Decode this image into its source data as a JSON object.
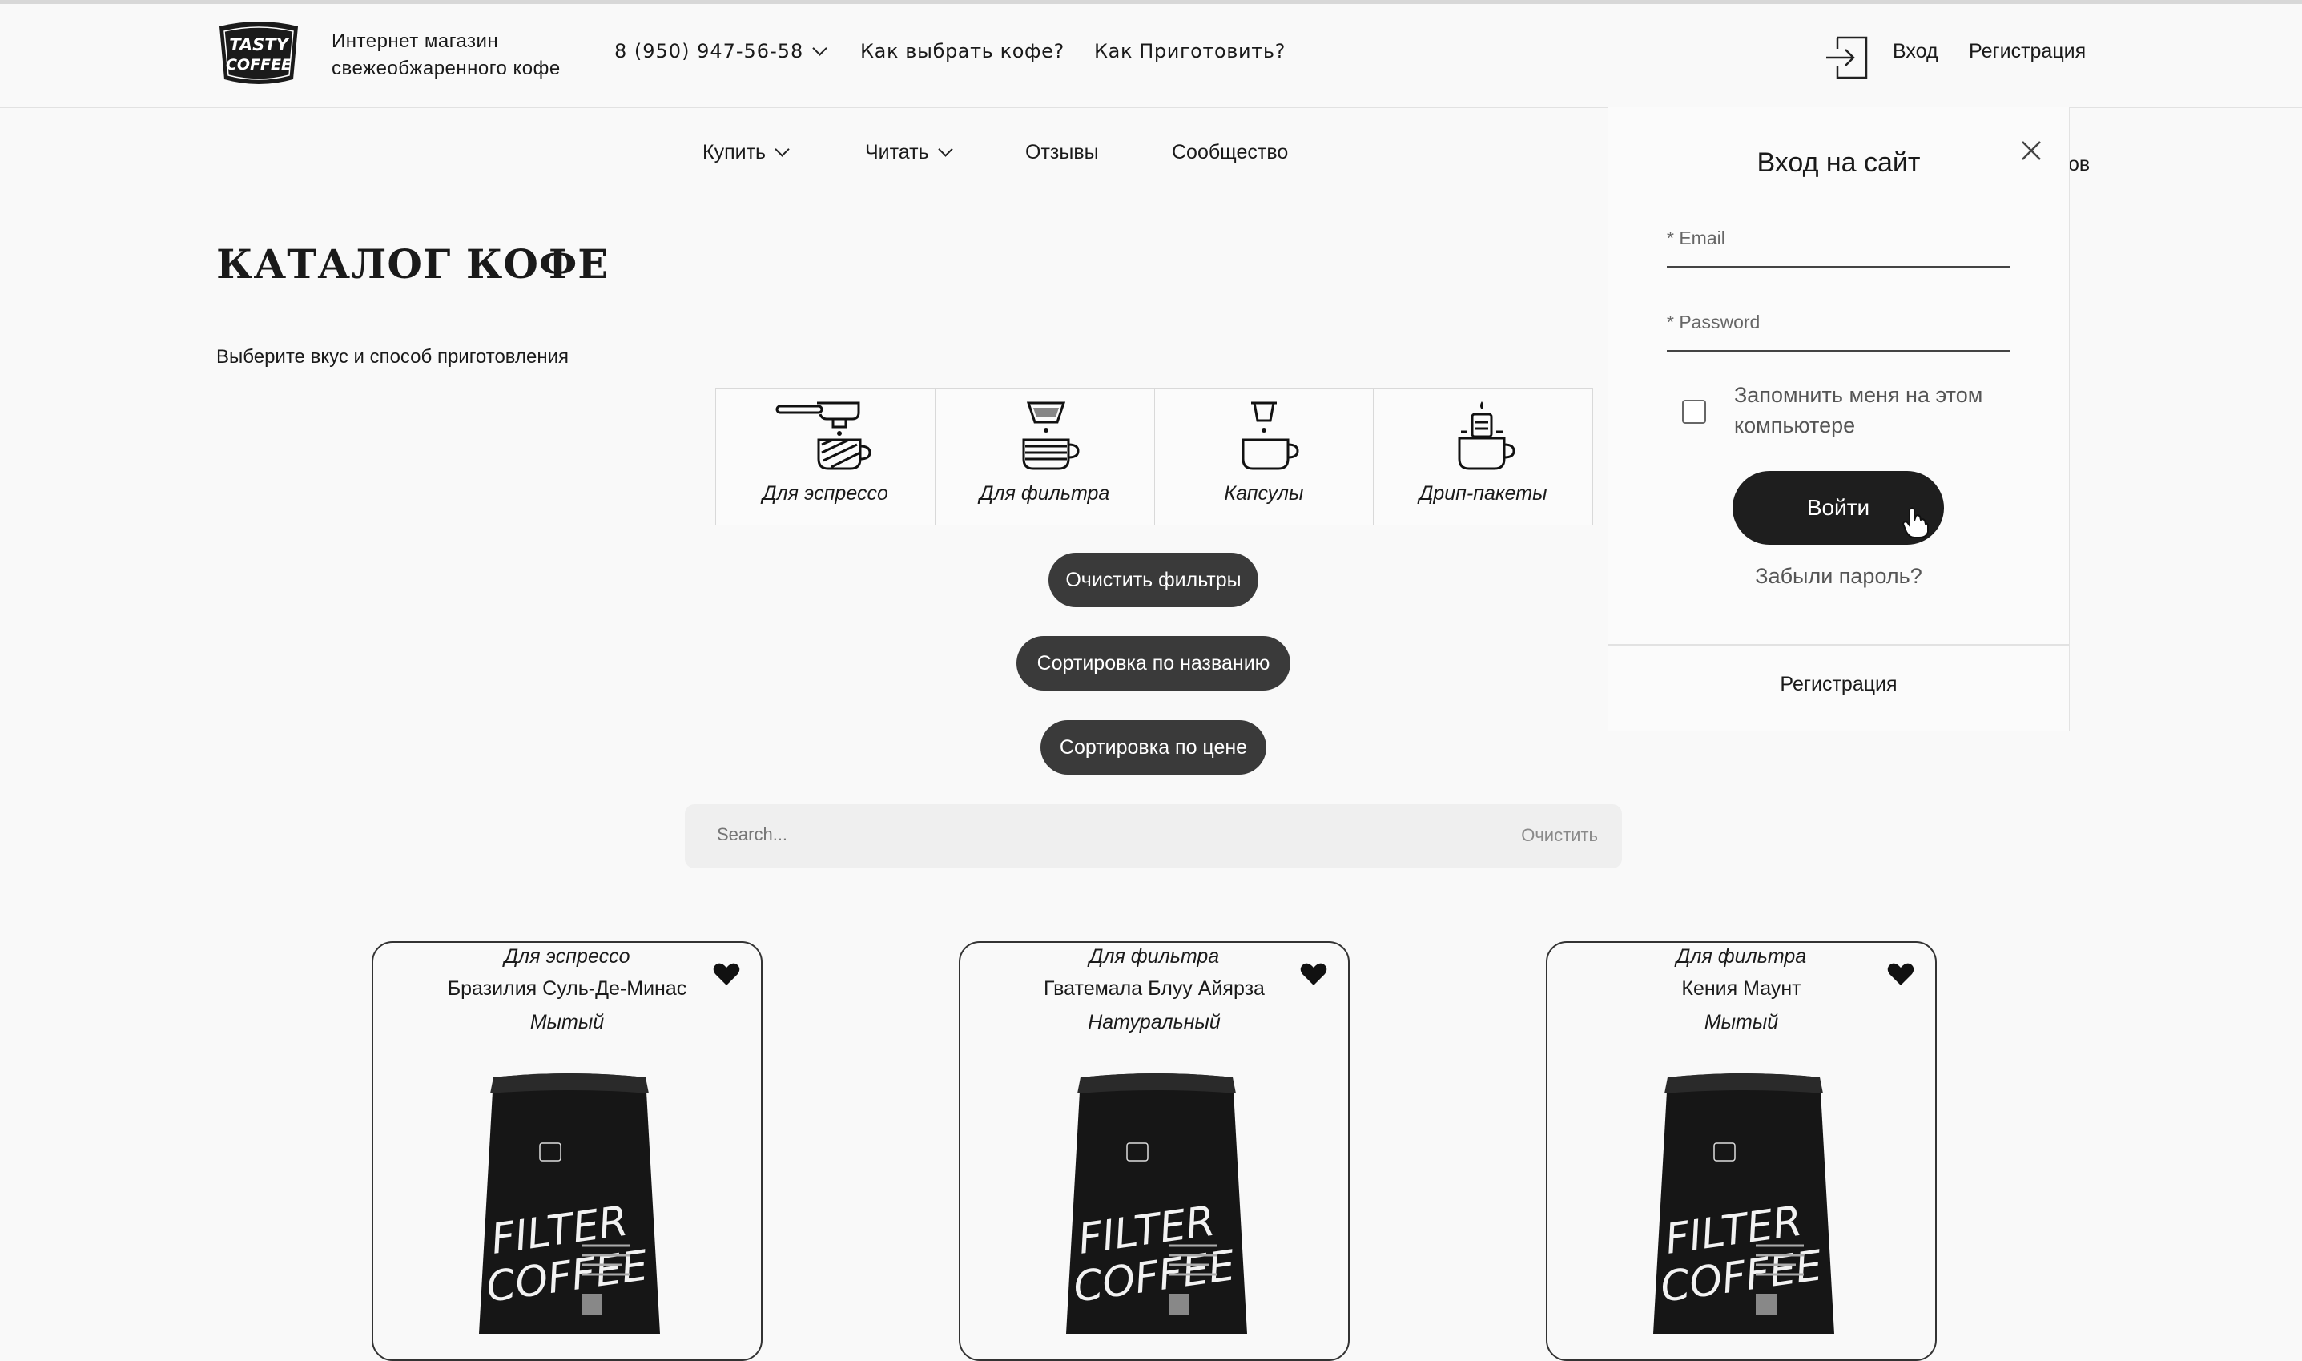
{
  "header": {
    "logo_text": "TASTY COFFEE",
    "shop_title_line1": "Интернет магазин",
    "shop_title_line2": "свежеобжаренного кофе",
    "phone": "8 (950) 947-56-58",
    "link_choose": "Как выбрать кофе?",
    "link_brew": "Как Приготовить?",
    "login": "Вход",
    "register": "Регистрация"
  },
  "nav": {
    "buy": "Купить",
    "read": "Читать",
    "reviews": "Отзывы",
    "community": "Сообщество",
    "hidden_partial": "ов"
  },
  "catalog": {
    "title": "КАТАЛОГ КОФЕ",
    "subtitle": "Выберите вкус и способ приготовления",
    "methods": [
      {
        "label": "Для эспрессо",
        "icon": "espresso-icon"
      },
      {
        "label": "Для фильтра",
        "icon": "filter-icon"
      },
      {
        "label": "Капсулы",
        "icon": "capsule-icon"
      },
      {
        "label": "Дрип-пакеты",
        "icon": "drip-bag-icon"
      }
    ],
    "clear_filters": "Очистить фильтры",
    "sort_name": "Сортировка по названию",
    "sort_price": "Сортировка по цене",
    "search_placeholder": "Search...",
    "search_clear": "Очистить"
  },
  "products": [
    {
      "method": "Для эспрессо",
      "name": "Бразилия Суль-Де-Минас",
      "process": "Мытый"
    },
    {
      "method": "Для фильтра",
      "name": "Гватемала Блуу Айярза",
      "process": "Натуральный"
    },
    {
      "method": "Для фильтра",
      "name": "Кения Маунт",
      "process": "Мытый"
    }
  ],
  "bag": {
    "line1": "FILTER",
    "line2": "COFFEE",
    "brand": "TASTY COFFEE"
  },
  "login_modal": {
    "title": "Вход на сайт",
    "email_label": "* Email",
    "password_label": "* Password",
    "remember": "Запомнить меня на этом компьютере",
    "submit": "Войти",
    "forgot": "Забыли пароль?",
    "register": "Регистрация"
  },
  "colors": {
    "background": "#f9f9f9",
    "pill": "#3a3a3a",
    "dark_button": "#1e1e1e",
    "text": "#1a1a1a"
  }
}
